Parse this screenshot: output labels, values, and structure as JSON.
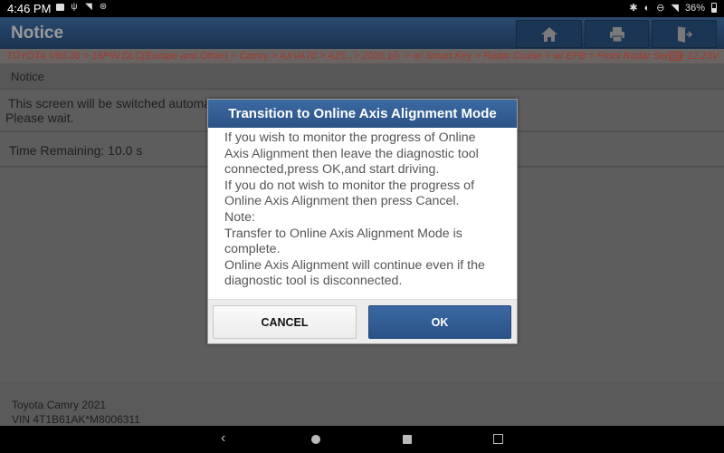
{
  "status_bar": {
    "time": "4:46 PM",
    "battery": "36%",
    "left_icons": [
      "image-icon",
      "usb-icon",
      "wifi-icon",
      "settings-icon"
    ],
    "right_icons": [
      "bluetooth-icon",
      "vibrate-icon",
      "dnd-icon",
      "wifi-icon",
      "battery-icon"
    ]
  },
  "header": {
    "title": "Notice",
    "buttons": [
      {
        "name": "home",
        "icon": "home-icon"
      },
      {
        "name": "print",
        "icon": "printer-icon"
      },
      {
        "name": "exit",
        "icon": "exit-icon"
      }
    ]
  },
  "breadcrumb": {
    "path": "TOYOTA V50.30 > 16PIN DLC(Europe and Other) > Camry > AXVA70 > A25...> 2020.10- > w/ Smart Key > Radar Cruise > w/ EPB > Front Radar Sensor",
    "voltage": "12.23V"
  },
  "content": {
    "section_title": "Notice",
    "message_line1": "This screen will be switched automa",
    "message_line2": "Please wait.",
    "time_remaining": "Time Remaining: 10.0 s"
  },
  "footer": {
    "vehicle": "Toyota Camry 2021",
    "vin": "VIN 4T1B61AK*M8006311"
  },
  "dialog": {
    "title": "Transition to Online Axis Alignment Mode",
    "paragraphs": [
      "If you wish to monitor the progress of Online Axis Alignment then leave the diagnostic tool connected,press OK,and start driving.",
      "If you do not wish to monitor the progress of Online Axis Alignment then press Cancel.",
      "Note:",
      "Transfer to Online Axis Alignment Mode is complete.",
      "Online Axis Alignment will continue even if the diagnostic tool is disconnected."
    ],
    "cancel_label": "CANCEL",
    "ok_label": "OK"
  },
  "colors": {
    "header_blue": "#1a3350",
    "dialog_title_blue": "#2b5387",
    "breadcrumb_text": "#a33a2c",
    "ok_button": "#2a5288"
  }
}
